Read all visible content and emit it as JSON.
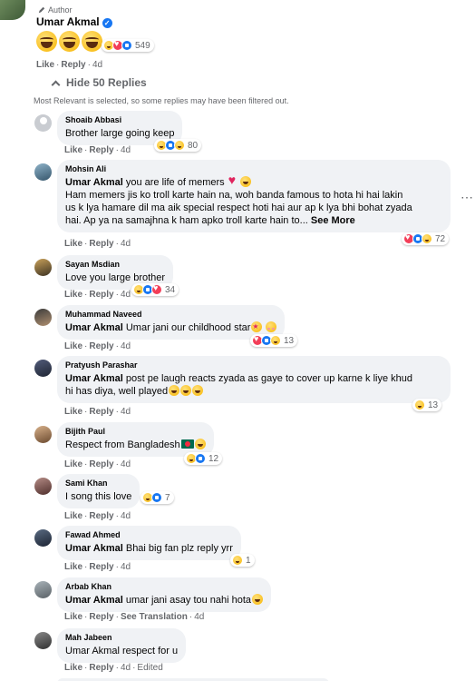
{
  "author": {
    "badge": "Author",
    "name": "Umar Akmal",
    "reaction_count": "549",
    "actions": {
      "like": "Like",
      "reply": "Reply",
      "time": "4d"
    }
  },
  "thread": {
    "hide_label": "Hide 50 Replies",
    "filter_note": "Most Relevant is selected, so some replies may have been filtered out."
  },
  "replies": [
    {
      "name": "Shoaib Abbasi",
      "text": "Brother large going keep",
      "count": "80",
      "like": "Like",
      "reply": "Reply",
      "time": "4d"
    },
    {
      "name": "Mohsin Ali",
      "mention": "Umar Akmal",
      "line1": " you are life of memers",
      "line2": "Ham memers jis ko troll karte hain na, woh banda famous to hota hi hai lakin",
      "line3": "us k lya hamare dil ma aik special respect hoti hai aur ap k lya bhi bohat zyada",
      "line4": "hai. Ap ya na samajhna k ham apko troll karte hain to...",
      "see_more": "See More",
      "count": "72",
      "like": "Like",
      "reply": "Reply",
      "time": "4d"
    },
    {
      "name": "Sayan Msdian",
      "text": "Love you large brother",
      "count": "34",
      "like": "Like",
      "reply": "Reply",
      "time": "4d"
    },
    {
      "name": "Muhammad Naveed",
      "mention": "Umar Akmal",
      "text": " Umar jani our childhood star",
      "count": "13",
      "like": "Like",
      "reply": "Reply",
      "time": "4d"
    },
    {
      "name": "Pratyush Parashar",
      "mention": "Umar Akmal",
      "line1": " post pe laugh reacts zyada as gaye to cover up karne k liye khud",
      "line2": "hi has diya, well played",
      "count": "13",
      "like": "Like",
      "reply": "Reply",
      "time": "4d"
    },
    {
      "name": "Bijith Paul",
      "text": "Respect from Bangladesh",
      "count": "12",
      "like": "Like",
      "reply": "Reply",
      "time": "4d"
    },
    {
      "name": "Sami Khan",
      "text": "I song this love",
      "count": "7",
      "like": "Like",
      "reply": "Reply",
      "time": "4d"
    },
    {
      "name": "Fawad Ahmed",
      "mention": "Umar Akmal",
      "text": " Bhai big fan plz reply yrr",
      "count": "1",
      "like": "Like",
      "reply": "Reply",
      "time": "4d"
    },
    {
      "name": "Arbab Khan",
      "mention": "Umar Akmal",
      "text": " umar jani asay tou nahi hota",
      "like": "Like",
      "reply": "Reply",
      "translation": "See Translation",
      "time": "4d"
    },
    {
      "name": "Mah Jabeen",
      "text": "Umar Akmal respect for u",
      "like": "Like",
      "reply": "Reply",
      "time": "4d",
      "edited": "Edited"
    }
  ]
}
